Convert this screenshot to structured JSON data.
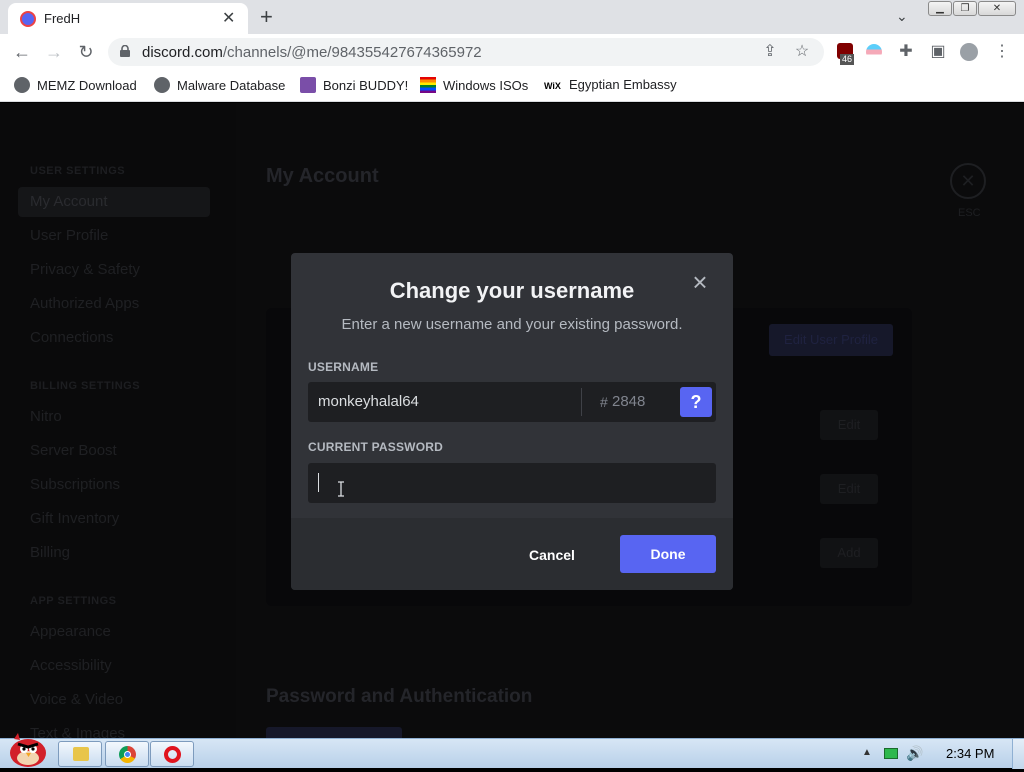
{
  "browser": {
    "tab_title": "FredH",
    "url_host": "discord.com",
    "url_path": "/channels/@me/984355427674365972",
    "extension_badge": "46",
    "bookmarks": [
      {
        "label": "MEMZ Download"
      },
      {
        "label": "Malware Database"
      },
      {
        "label": "Bonzi BUDDY!"
      },
      {
        "label": "Windows ISOs"
      },
      {
        "label": "Egyptian Embassy"
      }
    ]
  },
  "background": {
    "sidebar_sections": [
      {
        "heading": "USER SETTINGS",
        "items": [
          "My Account",
          "User Profile",
          "Privacy & Safety",
          "Authorized Apps",
          "Connections"
        ]
      },
      {
        "heading": "BILLING SETTINGS",
        "items": [
          "Nitro",
          "Server Boost",
          "Subscriptions",
          "Gift Inventory",
          "Billing"
        ]
      },
      {
        "heading": "APP SETTINGS",
        "items": [
          "Appearance",
          "Accessibility",
          "Voice & Video",
          "Text & Images"
        ]
      }
    ],
    "page_title": "My Account",
    "edit_profile_label": "Edit User Profile",
    "edit_labels": [
      "Edit",
      "Edit",
      "Add"
    ],
    "section_title": "Password and Authentication",
    "esc_label": "ESC"
  },
  "modal": {
    "title": "Change your username",
    "subtitle": "Enter a new username and your existing password.",
    "username_label": "USERNAME",
    "username_value": "monkeyhalal64",
    "discriminator_hash": "#",
    "discriminator": "2848",
    "help_label": "?",
    "password_label": "CURRENT PASSWORD",
    "password_value": "",
    "cancel_label": "Cancel",
    "done_label": "Done"
  },
  "taskbar": {
    "clock": "2:34 PM"
  },
  "colors": {
    "blurple": "#5865f2",
    "modal_bg": "#313338",
    "modal_footer": "#2b2d31",
    "input_bg": "#1e1f22"
  }
}
